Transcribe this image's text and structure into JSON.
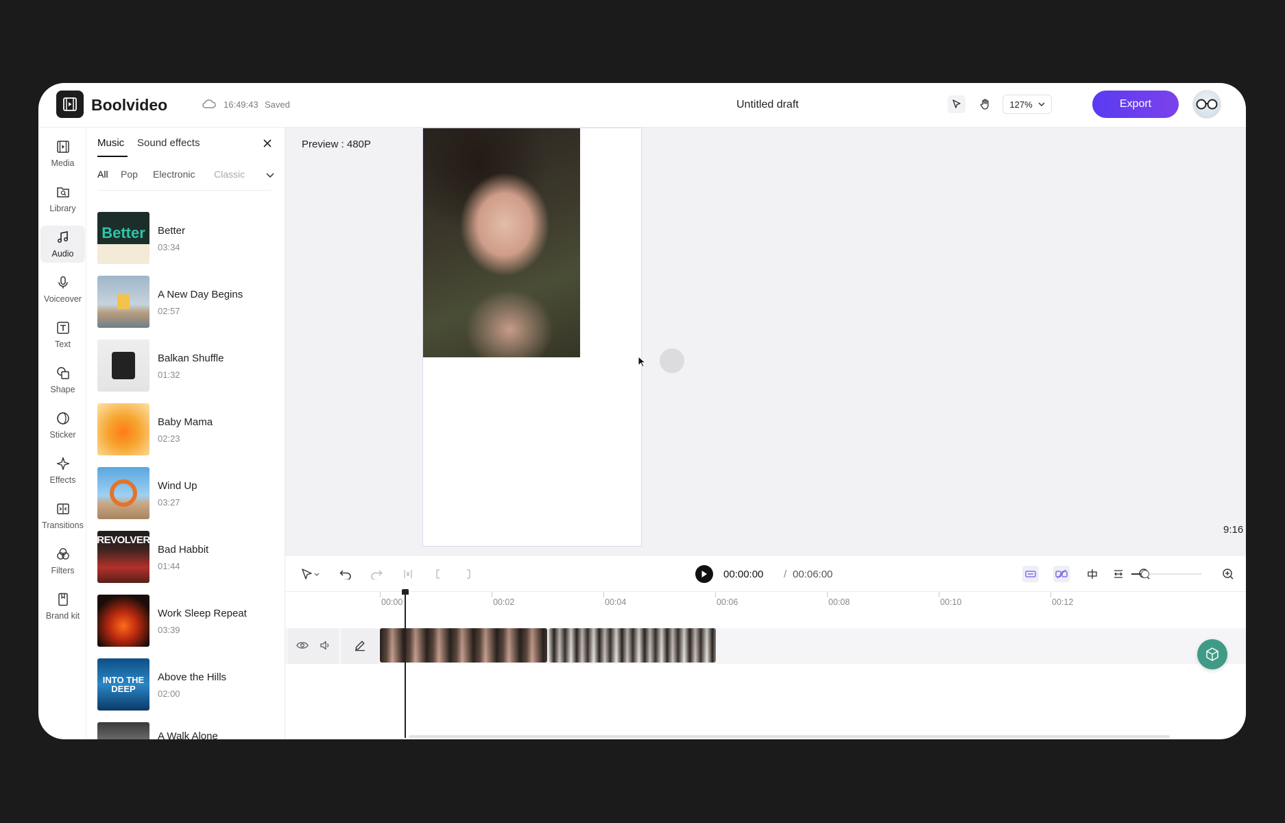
{
  "app": {
    "brand": "Boolvideo",
    "save_time": "16:49:43",
    "save_status": "Saved",
    "doc_title": "Untitled draft",
    "zoom": "127%",
    "export_label": "Export",
    "accent": "#6a3df0"
  },
  "sidebar": {
    "items": [
      {
        "label": "Media",
        "icon": "media-icon"
      },
      {
        "label": "Library",
        "icon": "library-icon"
      },
      {
        "label": "Audio",
        "icon": "music-note-icon"
      },
      {
        "label": "Voiceover",
        "icon": "microphone-icon"
      },
      {
        "label": "Text",
        "icon": "text-icon"
      },
      {
        "label": "Shape",
        "icon": "shape-icon"
      },
      {
        "label": "Sticker",
        "icon": "sticker-icon"
      },
      {
        "label": "Effects",
        "icon": "sparkle-icon"
      },
      {
        "label": "Transitions",
        "icon": "transitions-icon"
      },
      {
        "label": "Filters",
        "icon": "filters-icon"
      },
      {
        "label": "Brand kit",
        "icon": "bookmark-icon"
      }
    ],
    "active": "Audio"
  },
  "panel": {
    "tabs": [
      "Music",
      "Sound effects"
    ],
    "categories": [
      "All",
      "Pop",
      "Electronic",
      "Classic"
    ],
    "tracks": [
      {
        "title": "Better",
        "duration": "03:34",
        "cover_text": "Better"
      },
      {
        "title": "A New Day Begins",
        "duration": "02:57",
        "cover_text": ""
      },
      {
        "title": "Balkan Shuffle",
        "duration": "01:32",
        "cover_text": ""
      },
      {
        "title": "Baby Mama",
        "duration": "02:23",
        "cover_text": ""
      },
      {
        "title": "Wind Up",
        "duration": "03:27",
        "cover_text": ""
      },
      {
        "title": "Bad Habbit",
        "duration": "01:44",
        "cover_text": "REVOLVER"
      },
      {
        "title": "Work Sleep Repeat",
        "duration": "03:39",
        "cover_text": ""
      },
      {
        "title": "Above the Hills",
        "duration": "02:00",
        "cover_text": "INTO THE DEEP"
      },
      {
        "title": "A Walk Alone",
        "duration": "",
        "cover_text": ""
      }
    ]
  },
  "preview": {
    "label": "Preview : 480P",
    "aspect_ratio": "9:16"
  },
  "timeline": {
    "current_time": "00:00:00",
    "separator": "/",
    "total_time": "00:06:00",
    "ruler": [
      "00:00",
      "00:02",
      "00:04",
      "00:06",
      "00:08",
      "00:10",
      "00:12"
    ]
  }
}
